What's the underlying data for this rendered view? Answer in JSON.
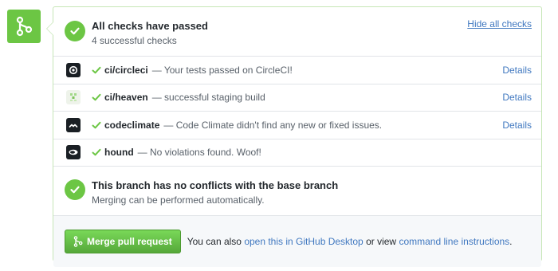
{
  "summary": {
    "title": "All checks have passed",
    "subtitle": "4 successful checks",
    "hide_link": "Hide all checks"
  },
  "checks": [
    {
      "name": "ci/circleci",
      "desc": "— Your tests passed on CircleCI!",
      "details": "Details",
      "icon": "circleci-icon"
    },
    {
      "name": "ci/heaven",
      "desc": "— successful staging build",
      "details": "Details",
      "icon": "heaven-icon"
    },
    {
      "name": "codeclimate",
      "desc": "— Code Climate didn't find any new or fixed issues.",
      "details": "Details",
      "icon": "codeclimate-icon"
    },
    {
      "name": "hound",
      "desc": "— No violations found. Woof!",
      "details": "",
      "icon": "hound-icon"
    }
  ],
  "branch": {
    "title": "This branch has no conflicts with the base branch",
    "subtitle": "Merging can be performed automatically."
  },
  "merge": {
    "button_label": "Merge pull request",
    "text_before": "You can also",
    "link_desktop": "open this in GitHub Desktop",
    "text_middle": "or view",
    "link_cli": "command line instructions",
    "text_after": "."
  },
  "colors": {
    "green": "#6cc644",
    "link": "#4078c0"
  }
}
